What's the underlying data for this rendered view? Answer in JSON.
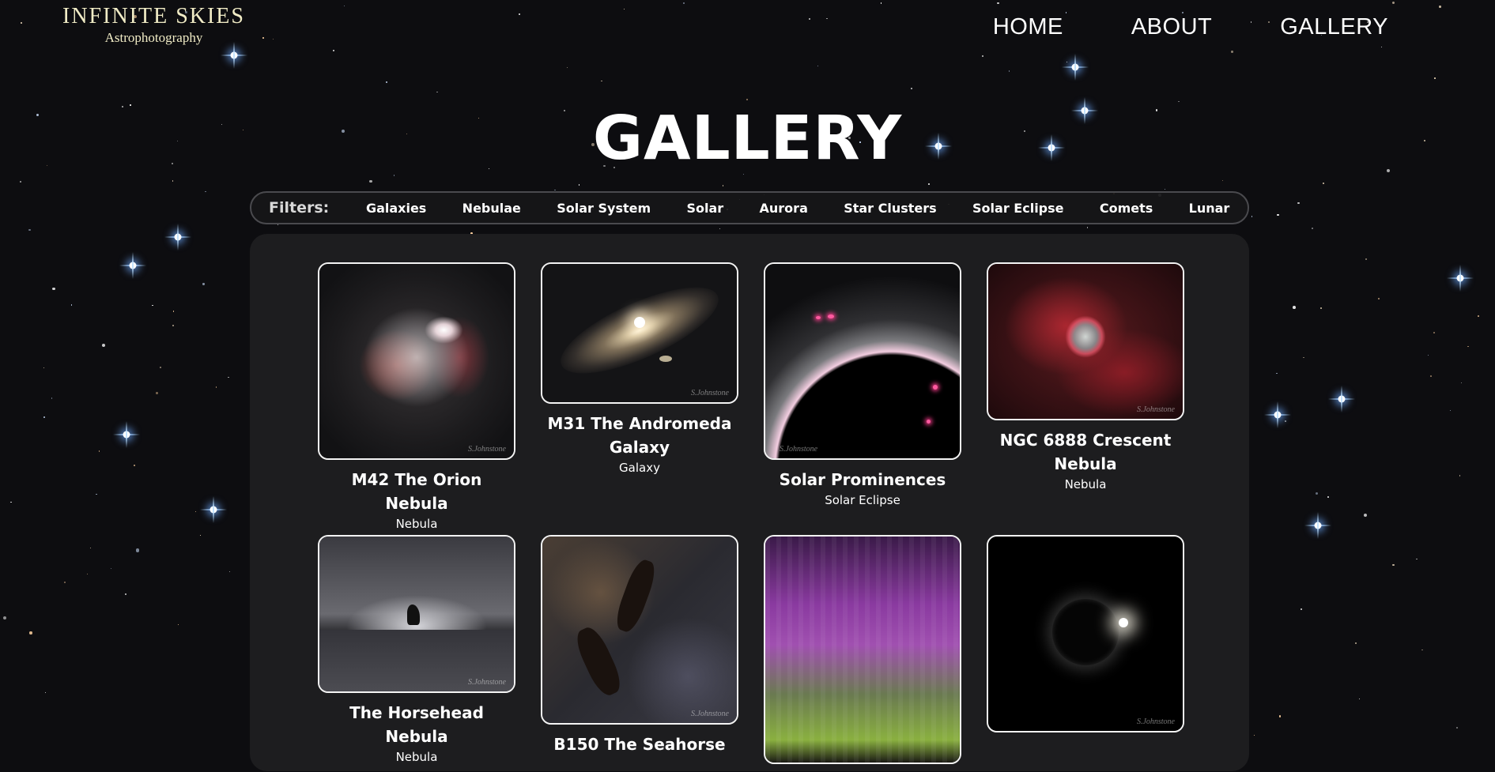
{
  "brand": {
    "title": "INFINITE SKIES",
    "subtitle": "Astrophotography"
  },
  "nav": [
    {
      "label": "HOME"
    },
    {
      "label": "ABOUT"
    },
    {
      "label": "GALLERY"
    }
  ],
  "page_title": "GALLERY",
  "filters": {
    "label": "Filters:",
    "items": [
      "Galaxies",
      "Nebulae",
      "Solar System",
      "Solar",
      "Aurora",
      "Star Clusters",
      "Solar Eclipse",
      "Comets",
      "Lunar"
    ]
  },
  "gallery": [
    {
      "title": "M42 The Orion Nebula",
      "category": "Nebula",
      "signature": "S.Johnstone"
    },
    {
      "title": "M31 The Andromeda Galaxy",
      "category": "Galaxy",
      "signature": "S.Johnstone"
    },
    {
      "title": "Solar Prominences",
      "category": "Solar Eclipse",
      "signature": "S.Johnstone"
    },
    {
      "title": "NGC 6888 Crescent Nebula",
      "category": "Nebula",
      "signature": "S.Johnstone"
    },
    {
      "title": "The Horsehead Nebula",
      "category": "Nebula",
      "signature": "S.Johnstone"
    },
    {
      "title": "B150 The Seahorse",
      "category": "",
      "signature": "S.Johnstone"
    },
    {
      "title": "",
      "category": "",
      "signature": ""
    },
    {
      "title": "",
      "category": "",
      "signature": "S.Johnstone"
    }
  ],
  "colors": {
    "brand_text": "#f1ecc6",
    "panel": "#1d1d1f",
    "background": "#0d0d10",
    "border": "#f4f4f4"
  }
}
